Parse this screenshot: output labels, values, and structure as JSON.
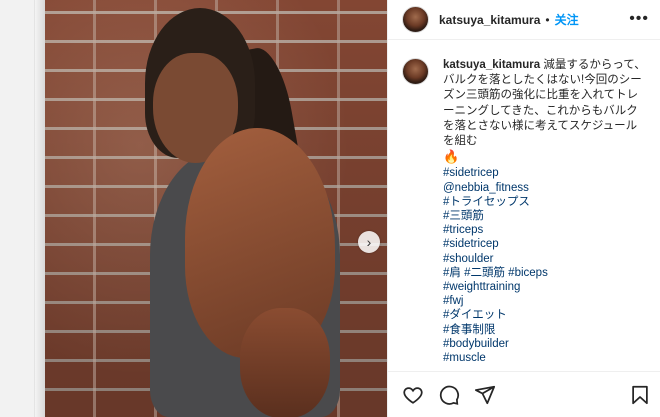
{
  "post": {
    "username": "katsuya_kitamura",
    "separator": "•",
    "follow_label": "关注",
    "more_label": "•••"
  },
  "caption": {
    "username": "katsuya_kitamura",
    "text": "減量するからって、バルクを落としたくはない!今回のシーズン三頭筋の強化に比重を入れてトレーニングしてきた、これからもバルクを落とさない様に考えてスケジュールを組む",
    "emoji": "🔥",
    "hashtags": [
      "#sidetricep",
      "@nebbia_fitness",
      "#トライセップス",
      "#三頭筋",
      "#triceps",
      "#sidetricep",
      "#shoulder",
      "#肩 #二頭筋 #biceps",
      "#weighttraining",
      "#fwj",
      "#ダイエット",
      "#食事制限",
      "#bodybuilder",
      "#muscle"
    ]
  },
  "carousel": {
    "next_glyph": "›"
  },
  "icons": {
    "like": "heart-icon",
    "comment": "comment-icon",
    "share": "share-icon",
    "save": "bookmark-icon"
  },
  "colors": {
    "accent": "#0095f6",
    "tag": "#00376b",
    "text": "#262626"
  }
}
